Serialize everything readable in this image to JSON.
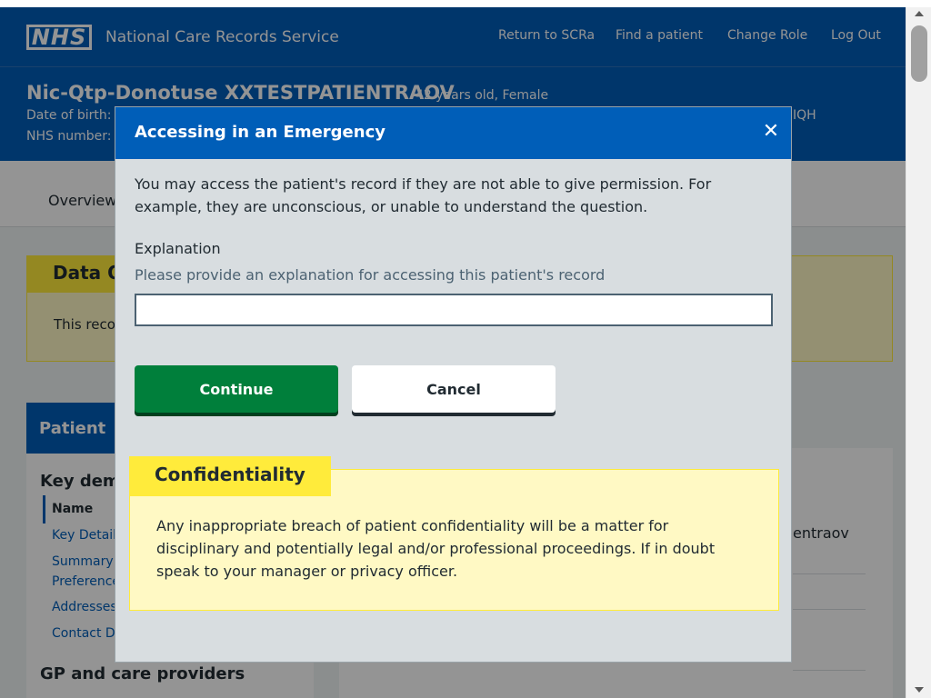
{
  "header": {
    "logo_text": "NHS",
    "service_name": "National Care Records Service",
    "nav": [
      "Return to SCRa",
      "Find a patient",
      "Change Role",
      "Log Out"
    ]
  },
  "patient": {
    "name": "Nic-Qtp-Donotuse XXTESTPATIENTRAOV",
    "age_gender": "42 years old, Female",
    "dob_label": "Date of birth:",
    "nhs_label": "NHS number:",
    "postcode_fragment": "IQH"
  },
  "tabs": {
    "overview": "Overview"
  },
  "background": {
    "data_quality_title": "Data Q",
    "data_quality_text": "This reco",
    "sidebar_title": "Patient",
    "sidebar_subtitle": "Key dem",
    "sidebar_items": [
      "Name",
      "Key Detail",
      "Summary",
      "Preference",
      "Addresses",
      "Contact De"
    ],
    "gp_title": "GP and care providers",
    "main_fragment": "entraov"
  },
  "modal": {
    "title": "Accessing in an Emergency",
    "close_symbol": "✕",
    "intro": "You may access the patient's record if they are not able to give permission. For example, they are unconscious, or unable to understand the question.",
    "explanation_label": "Explanation",
    "explanation_hint": "Please provide an explanation for accessing this patient's record",
    "explanation_value": "",
    "continue_label": "Continue",
    "cancel_label": "Cancel",
    "confidentiality_title": "Confidentiality",
    "confidentiality_text": "Any inappropriate breach of patient confidentiality will be a matter for disciplinary and potentially legal and/or professional proceedings. If in doubt speak to your manager or privacy officer."
  },
  "colors": {
    "nhs_blue": "#005eb8",
    "continue_green": "#007f3b",
    "warning_yellow": "#ffeb3b",
    "warning_bg": "#fff9c4"
  }
}
